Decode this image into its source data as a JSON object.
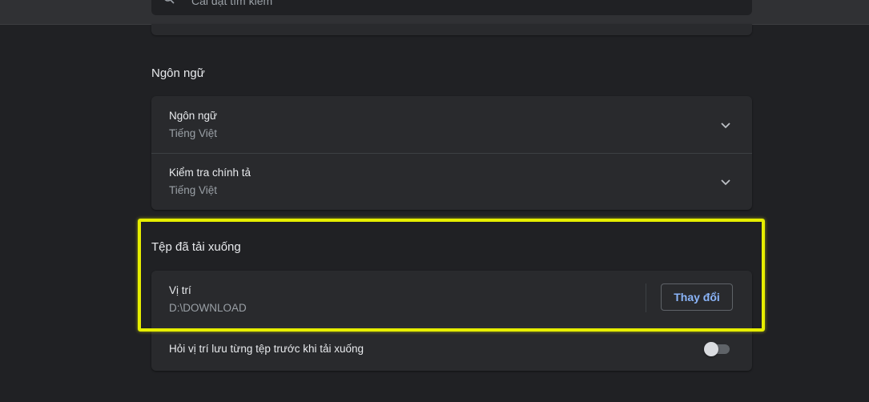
{
  "search": {
    "placeholder": "Cài đặt tìm kiếm"
  },
  "sections": {
    "language": {
      "title": "Ngôn ngữ",
      "rows": [
        {
          "title": "Ngôn ngữ",
          "value": "Tiếng Việt"
        },
        {
          "title": "Kiểm tra chính tả",
          "value": "Tiếng Việt"
        }
      ]
    },
    "downloads": {
      "title": "Tệp đã tải xuống",
      "location": {
        "title": "Vị trí",
        "value": "D:\\DOWNLOAD",
        "change_label": "Thay đổi"
      },
      "ask_location": {
        "label": "Hỏi vị trí lưu từng tệp trước khi tải xuống",
        "enabled": false
      }
    }
  },
  "colors": {
    "background": "#202124",
    "card": "#292a2d",
    "accent": "#8ab4f8",
    "highlight": "#e6ee00"
  }
}
